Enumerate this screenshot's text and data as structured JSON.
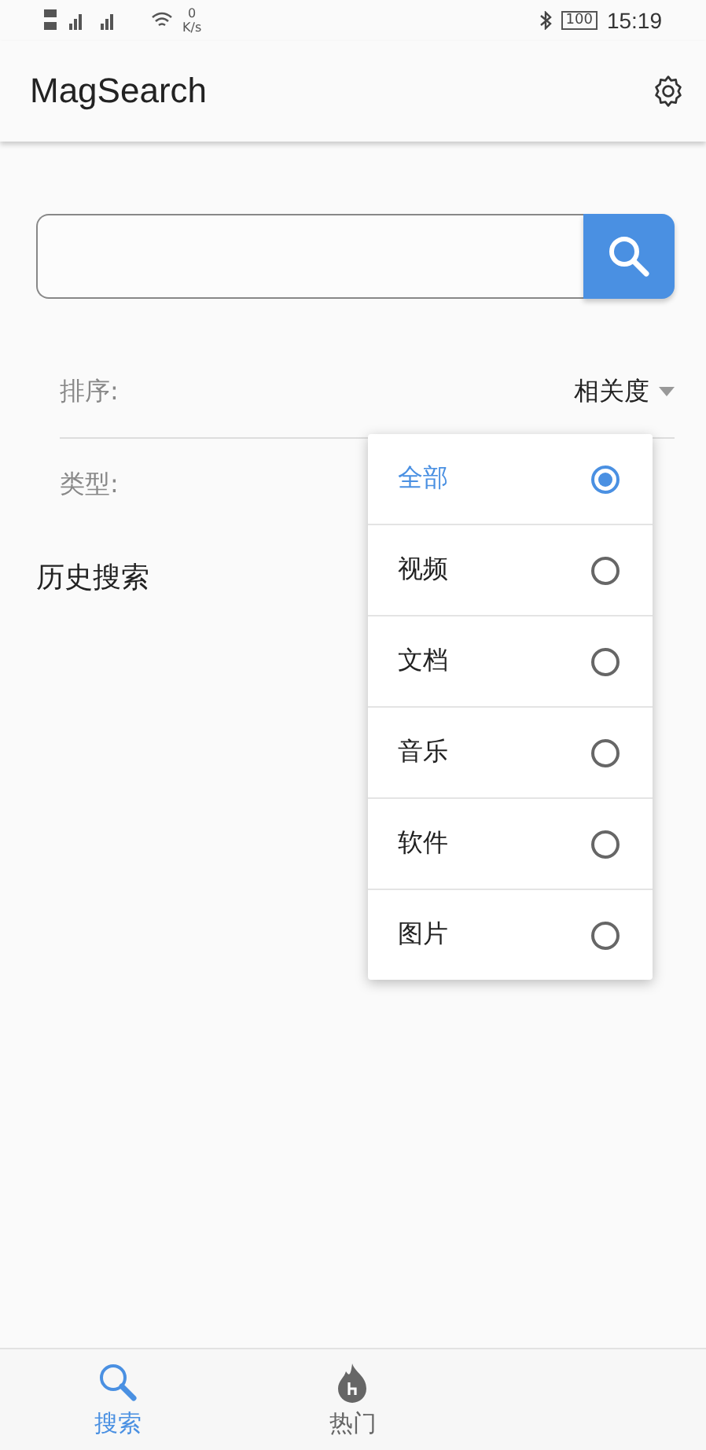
{
  "status_bar": {
    "speed_value": "0",
    "speed_unit": "K/s",
    "battery": "100",
    "time": "15:19"
  },
  "app_bar": {
    "title": "MagSearch"
  },
  "filters": [
    {
      "label": "排序:",
      "value": "相关度"
    },
    {
      "label": "类型:"
    }
  ],
  "history": {
    "title": "历史搜索"
  },
  "type_menu": [
    {
      "label": "全部",
      "selected": true
    },
    {
      "label": "视频",
      "selected": false
    },
    {
      "label": "文档",
      "selected": false
    },
    {
      "label": "音乐",
      "selected": false
    },
    {
      "label": "软件",
      "selected": false
    },
    {
      "label": "图片",
      "selected": false
    }
  ],
  "bottom_nav": [
    {
      "label": "搜索",
      "kind": "search",
      "selected": true
    },
    {
      "label": "热门",
      "kind": "hot",
      "selected": false
    }
  ]
}
